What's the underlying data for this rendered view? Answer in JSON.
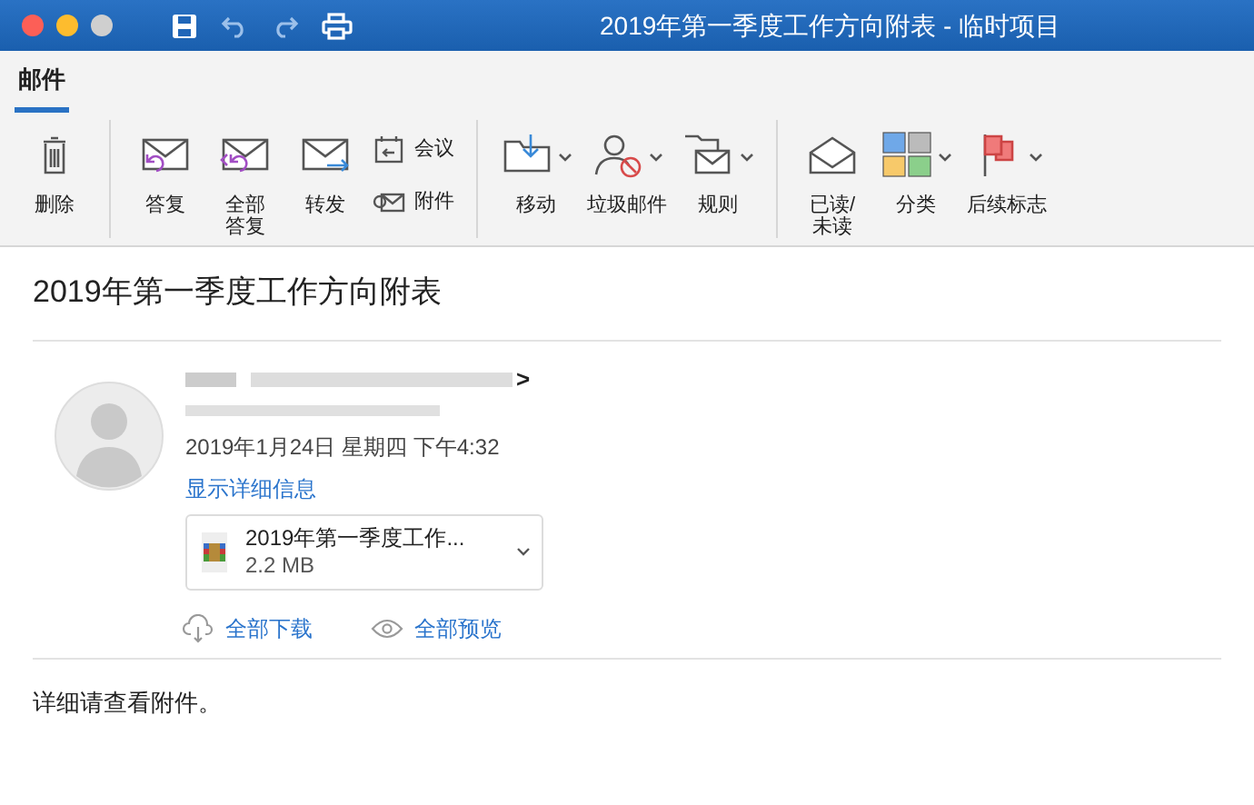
{
  "window": {
    "title": "2019年第一季度工作方向附表 - 临时项目"
  },
  "tabs": [
    {
      "label": "邮件",
      "selected": true
    }
  ],
  "ribbon": {
    "groups": [
      [
        {
          "lines": [
            "删除"
          ],
          "kind": "large",
          "dropdown": false
        }
      ],
      [
        {
          "lines": [
            "答复"
          ],
          "kind": "large",
          "dropdown": false
        },
        {
          "lines": [
            "全部",
            "答复"
          ],
          "kind": "large",
          "dropdown": false
        },
        {
          "lines": [
            "转发"
          ],
          "kind": "large",
          "dropdown": false
        },
        {
          "lines": [
            "会议"
          ],
          "kind": "small"
        },
        {
          "lines": [
            "附件"
          ],
          "kind": "small"
        }
      ],
      [
        {
          "lines": [
            "移动"
          ],
          "kind": "large",
          "dropdown": true
        },
        {
          "lines": [
            "垃圾邮件"
          ],
          "kind": "large",
          "dropdown": true
        },
        {
          "lines": [
            "规则"
          ],
          "kind": "large",
          "dropdown": true
        }
      ],
      [
        {
          "lines": [
            "已读/",
            "未读"
          ],
          "kind": "large",
          "dropdown": false
        },
        {
          "lines": [
            "分类"
          ],
          "kind": "large",
          "dropdown": true
        },
        {
          "lines": [
            "后续标志"
          ],
          "kind": "large",
          "dropdown": true
        }
      ]
    ]
  },
  "message": {
    "subject": "2019年第一季度工作方向附表",
    "sender_suffix": ">",
    "date": "2019年1月24日 星期四 下午4:32",
    "details_link": "显示详细信息",
    "attachment": {
      "name": "2019年第一季度工作...",
      "size": "2.2 MB"
    },
    "actions": [
      "全部下载",
      "全部预览"
    ],
    "body": "详细请查看附件。"
  }
}
